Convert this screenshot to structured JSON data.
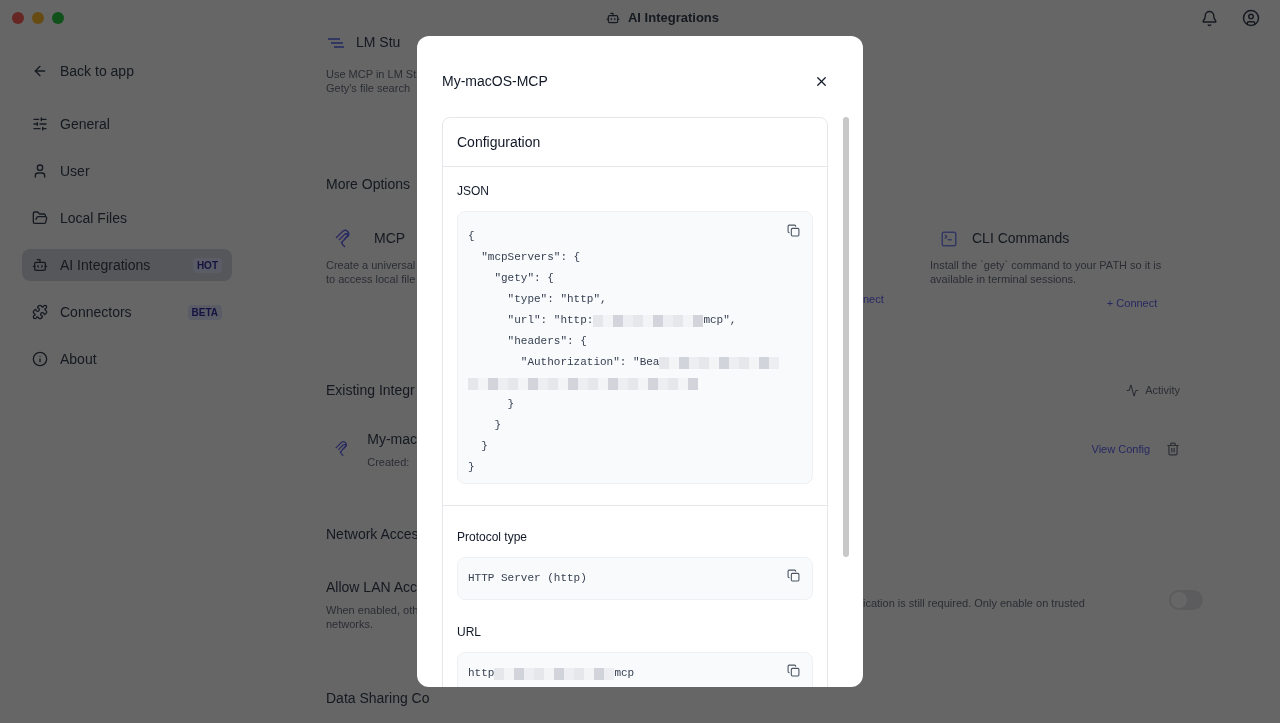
{
  "window": {
    "title": "AI Integrations"
  },
  "sidebar": {
    "back": "Back to app",
    "items": [
      {
        "label": "General",
        "selected": false
      },
      {
        "label": "User",
        "selected": false
      },
      {
        "label": "Local Files",
        "selected": false
      },
      {
        "label": "AI Integrations",
        "selected": true,
        "badge": "HOT"
      },
      {
        "label": "Connectors",
        "selected": false,
        "badge": "BETA"
      },
      {
        "label": "About",
        "selected": false
      }
    ]
  },
  "background": {
    "lm_title": "LM Stu",
    "lm_desc": [
      "Use MCP in LM St",
      "Gety's file search"
    ],
    "more_options": "More Options",
    "mcp_card": {
      "title": "MCP",
      "desc": [
        "Create a universal",
        "to access local file"
      ]
    },
    "middle_connect": "nect",
    "cli_card": {
      "title": "CLI Commands",
      "desc": [
        "Install the `gety` command to your PATH so it is",
        "available in terminal sessions."
      ],
      "connect": "+ Connect"
    },
    "existing": "Existing Integr",
    "activity": "Activity",
    "integration": {
      "name": "My-mac",
      "created": "Created: ",
      "view": "View Config"
    },
    "network": "Network Acces",
    "lan": {
      "title": "Allow LAN Acc",
      "desc_left": [
        "When enabled, oth",
        "networks."
      ],
      "desc_right": "ication is still required. Only enable on trusted",
      "on": false
    },
    "data_sharing": "Data Sharing Co"
  },
  "modal": {
    "title": "My-macOS-MCP",
    "card_title": "Configuration",
    "json_label": "JSON",
    "json_lines": [
      [
        {
          "kind": "text",
          "text": "{"
        }
      ],
      [
        {
          "kind": "text",
          "text": "  \"mcpServers\": {"
        }
      ],
      [
        {
          "kind": "text",
          "text": "    \"gety\": {"
        }
      ],
      [
        {
          "kind": "text",
          "text": "      \"type\": \"http\","
        }
      ],
      [
        {
          "kind": "text",
          "text": "      \"url\": \"http:"
        },
        {
          "kind": "redacted"
        },
        {
          "kind": "text",
          "text": "mcp\","
        }
      ],
      [
        {
          "kind": "text",
          "text": "      \"headers\": {"
        }
      ],
      [
        {
          "kind": "text",
          "text": "        \"Authorization\": \"Bea"
        },
        {
          "kind": "redacted"
        }
      ],
      [
        {
          "kind": "redacted"
        }
      ],
      [
        {
          "kind": "text",
          "text": "      }"
        }
      ],
      [
        {
          "kind": "text",
          "text": "    }"
        }
      ],
      [
        {
          "kind": "text",
          "text": "  }"
        }
      ],
      [
        {
          "kind": "text",
          "text": "}"
        }
      ]
    ],
    "protocol_label": "Protocol type",
    "protocol_value": "HTTP Server (http)",
    "url_label": "URL",
    "url_parts": [
      {
        "kind": "text",
        "text": "http"
      },
      {
        "kind": "redacted"
      },
      {
        "kind": "text",
        "text": "mcp"
      }
    ]
  }
}
